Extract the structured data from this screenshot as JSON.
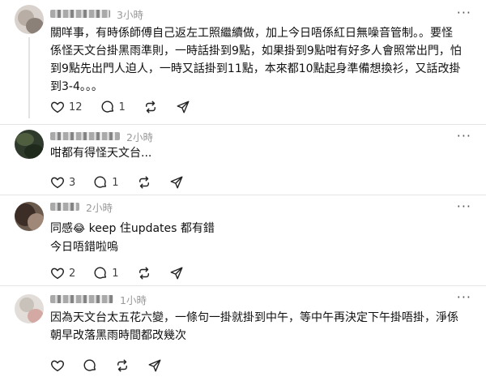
{
  "posts": [
    {
      "time": "3小時",
      "lines": [
        "關咩事，有時係師傅自己返左工照繼續做，加上今日唔係紅日無噪音管制。。要怪",
        "係怪天文台掛黑雨準則，一時話掛到9點，如果掛到9點咁有好多人會照常出門，怕",
        "到9點先出門人迫人，一時又話掛到11點，本來都10點起身準備想換衫，又話改掛",
        "到3-4。。。"
      ],
      "likes": "12",
      "replies": "1",
      "reposts": "",
      "shares": ""
    },
    {
      "time": "2小時",
      "lines": [
        "咁都有得怪天文台..."
      ],
      "likes": "3",
      "replies": "1",
      "reposts": "",
      "shares": ""
    },
    {
      "time": "2小時",
      "line1_before": "同感",
      "emoji": "😂",
      "line1_after": " keep 住updates 都有錯",
      "line2": "今日唔錯啦嗚",
      "likes": "2",
      "replies": "1",
      "reposts": "",
      "shares": ""
    },
    {
      "time": "1小時",
      "lines": [
        "因為天文台太五花六變，一條句一掛就掛到中午，等中午再決定下午掛唔掛，淨係",
        "朝早改落黑雨時間都改幾次"
      ],
      "likes": "",
      "replies": "",
      "reposts": "",
      "shares": ""
    }
  ],
  "more_label": "···",
  "icons": [
    "heart-icon",
    "comment-icon",
    "repost-icon",
    "share-icon"
  ]
}
